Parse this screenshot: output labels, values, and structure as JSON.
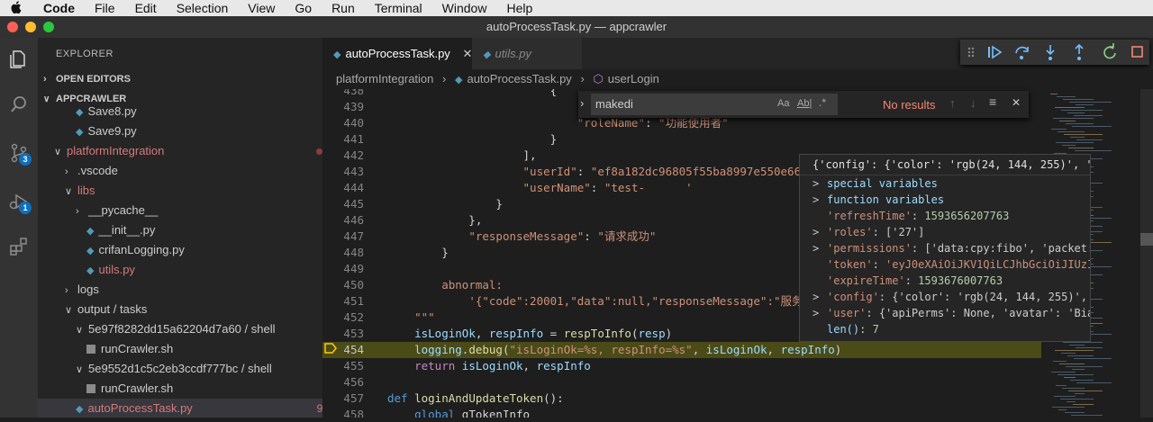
{
  "menu": {
    "app": "Code",
    "items": [
      "File",
      "Edit",
      "Selection",
      "View",
      "Go",
      "Run",
      "Terminal",
      "Window",
      "Help"
    ]
  },
  "window": {
    "title": "autoProcessTask.py — appcrawler"
  },
  "activity": {
    "source_control_badge": "3",
    "debug_badge": "1"
  },
  "explorer": {
    "title": "EXPLORER",
    "open_editors": "OPEN EDITORS",
    "root": "APPCRAWLER",
    "rows": [
      {
        "label": "Save8.py",
        "indent": 42,
        "kind": "py"
      },
      {
        "label": "Save9.py",
        "indent": 42,
        "kind": "py"
      },
      {
        "label": "platformIntegration",
        "indent": 18,
        "kind": "folder-open",
        "mod": true
      },
      {
        "label": ".vscode",
        "indent": 30,
        "kind": "folder"
      },
      {
        "label": "libs",
        "indent": 30,
        "kind": "folder-open",
        "mod": true
      },
      {
        "label": "__pycache__",
        "indent": 42,
        "kind": "folder"
      },
      {
        "label": "__init__.py",
        "indent": 54,
        "kind": "py"
      },
      {
        "label": "crifanLogging.py",
        "indent": 54,
        "kind": "py"
      },
      {
        "label": "utils.py",
        "indent": 54,
        "kind": "py",
        "badge": "9+"
      },
      {
        "label": "logs",
        "indent": 30,
        "kind": "folder"
      },
      {
        "label": "output / tasks",
        "indent": 30,
        "kind": "folder-open"
      },
      {
        "label": "5e97f8282dd15a62204d7a60 / shell",
        "indent": 42,
        "kind": "folder-open"
      },
      {
        "label": "runCrawler.sh",
        "indent": 54,
        "kind": "sh"
      },
      {
        "label": "5e9552d1c5c2eb3ccdf777bc / shell",
        "indent": 42,
        "kind": "folder-open"
      },
      {
        "label": "runCrawler.sh",
        "indent": 54,
        "kind": "sh"
      },
      {
        "label": "autoProcessTask.py",
        "indent": 42,
        "kind": "py",
        "badge": "9+, M"
      }
    ]
  },
  "tabs": [
    {
      "label": "autoProcessTask.py",
      "active": true
    },
    {
      "label": "utils.py",
      "active": false
    }
  ],
  "breadcrumb": {
    "folder": "platformIntegration",
    "file": "autoProcessTask.py",
    "symbol": "userLogin"
  },
  "find": {
    "query": "makedi",
    "aa": "Aa",
    "ab": "Ab|",
    "regex": ".*",
    "result": "No results"
  },
  "code_lines": [
    {
      "n": "438",
      "segs": [
        [
          "                        {",
          ""
        ]
      ]
    },
    {
      "n": "439",
      "segs": [
        [
          "                            ",
          ""
        ]
      ]
    },
    {
      "n": "440",
      "segs": [
        [
          "                            ",
          ""
        ],
        [
          "\"roleName\"",
          "str"
        ],
        [
          ": ",
          ""
        ],
        [
          "\"功能使用者\"",
          "str"
        ]
      ]
    },
    {
      "n": "441",
      "segs": [
        [
          "                        }",
          ""
        ]
      ]
    },
    {
      "n": "442",
      "segs": [
        [
          "                    ],",
          ""
        ]
      ]
    },
    {
      "n": "443",
      "segs": [
        [
          "                    ",
          ""
        ],
        [
          "\"userId\"",
          "str"
        ],
        [
          ": ",
          ""
        ],
        [
          "\"ef8a182dc96805f55ba8997e550e66a7",
          "str"
        ]
      ]
    },
    {
      "n": "444",
      "segs": [
        [
          "                    ",
          ""
        ],
        [
          "\"userName\"",
          "str"
        ],
        [
          ": ",
          ""
        ],
        [
          "\"test-      '",
          "str"
        ]
      ]
    },
    {
      "n": "445",
      "segs": [
        [
          "                }",
          ""
        ]
      ]
    },
    {
      "n": "446",
      "segs": [
        [
          "            },",
          ""
        ]
      ]
    },
    {
      "n": "447",
      "segs": [
        [
          "            ",
          ""
        ],
        [
          "\"responseMessage\"",
          "str"
        ],
        [
          ": ",
          ""
        ],
        [
          "\"请求成功\"",
          "str"
        ]
      ]
    },
    {
      "n": "448",
      "segs": [
        [
          "        }",
          ""
        ]
      ]
    },
    {
      "n": "449",
      "segs": [
        [
          "",
          ""
        ]
      ]
    },
    {
      "n": "450",
      "segs": [
        [
          "        ",
          ""
        ],
        [
          "abnormal:",
          "str"
        ]
      ]
    },
    {
      "n": "451",
      "segs": [
        [
          "            ",
          ""
        ],
        [
          "'{\"code\":20001,\"data\":null,\"responseMessage\":\"服务内",
          "str"
        ]
      ]
    },
    {
      "n": "452",
      "segs": [
        [
          "    ",
          ""
        ],
        [
          "\"\"\"",
          "str"
        ]
      ]
    },
    {
      "n": "453",
      "segs": [
        [
          "    ",
          ""
        ],
        [
          "isLoginOk",
          "var"
        ],
        [
          ", ",
          ""
        ],
        [
          "respInfo",
          "var"
        ],
        [
          " = ",
          ""
        ],
        [
          "respToInfo",
          "fn"
        ],
        [
          "(",
          ""
        ],
        [
          "resp",
          "var"
        ],
        [
          ")",
          ""
        ]
      ]
    },
    {
      "n": "454",
      "segs": [
        [
          "    ",
          ""
        ],
        [
          "logging",
          "var"
        ],
        [
          ".",
          ""
        ],
        [
          "debug",
          "fn"
        ],
        [
          "(",
          ""
        ],
        [
          "\"isLoginOk=%s, respInfo=%s\"",
          "str"
        ],
        [
          ", ",
          ""
        ],
        [
          "isLoginOk",
          "var"
        ],
        [
          ", ",
          ""
        ],
        [
          "respInfo",
          "var"
        ],
        [
          ")",
          ""
        ]
      ],
      "current": true
    },
    {
      "n": "455",
      "segs": [
        [
          "    ",
          ""
        ],
        [
          "return",
          "kw"
        ],
        [
          " ",
          ""
        ],
        [
          "isLoginOk",
          "var"
        ],
        [
          ", ",
          ""
        ],
        [
          "respInfo",
          "var"
        ]
      ]
    },
    {
      "n": "456",
      "segs": [
        [
          "",
          ""
        ]
      ]
    },
    {
      "n": "457",
      "segs": [
        [
          "def",
          "kwb"
        ],
        [
          " ",
          ""
        ],
        [
          "loginAndUpdateToken",
          "fn"
        ],
        [
          "():",
          ""
        ]
      ]
    },
    {
      "n": "458",
      "segs": [
        [
          "    ",
          ""
        ],
        [
          "global",
          "kwb"
        ],
        [
          " gTokenInfo",
          ""
        ]
      ]
    }
  ],
  "hover": {
    "header": "{'config': {'color': 'rgb(24, 144, 255)', 'fi",
    "rows": [
      {
        "chev": ">",
        "parts": [
          [
            "special variables",
            "var"
          ]
        ]
      },
      {
        "chev": ">",
        "parts": [
          [
            "function variables",
            "var"
          ]
        ]
      },
      {
        "chev": "",
        "parts": [
          [
            "'refreshTime'",
            "str"
          ],
          [
            ": ",
            ""
          ],
          [
            "1593656207763",
            "num"
          ]
        ]
      },
      {
        "chev": ">",
        "parts": [
          [
            "'roles'",
            "str"
          ],
          [
            ": ",
            ""
          ],
          [
            "['27']",
            ""
          ]
        ]
      },
      {
        "chev": ">",
        "parts": [
          [
            "'permissions'",
            "str"
          ],
          [
            ": ",
            ""
          ],
          [
            "['data:cpy:fibo', 'packet:vie",
            ""
          ]
        ]
      },
      {
        "chev": "",
        "parts": [
          [
            "'token'",
            "str"
          ],
          [
            ": ",
            ""
          ],
          [
            "'eyJ0eXAiOiJKV1QiLCJhbGciOiJIUzI1Ni",
            "str"
          ]
        ]
      },
      {
        "chev": "",
        "parts": [
          [
            "'expireTime'",
            "str"
          ],
          [
            ": ",
            ""
          ],
          [
            "1593676007763",
            "num"
          ]
        ]
      },
      {
        "chev": ">",
        "parts": [
          [
            "'config'",
            "str"
          ],
          [
            ": ",
            ""
          ],
          [
            "{'color': 'rgb(24, 144, 255)', 'fi",
            ""
          ]
        ]
      },
      {
        "chev": ">",
        "parts": [
          [
            "'user'",
            "str"
          ],
          [
            ": ",
            ""
          ],
          [
            "{'apiPerms': None, 'avatar': 'Biazfo",
            ""
          ]
        ]
      },
      {
        "chev": "",
        "parts": [
          [
            "len()",
            "var"
          ],
          [
            ": ",
            ""
          ],
          [
            "7",
            "num"
          ]
        ]
      }
    ]
  },
  "colors": {
    "accent": "#0e70c0",
    "modified": "#d47a7a",
    "current_line": "#4b4b18"
  }
}
